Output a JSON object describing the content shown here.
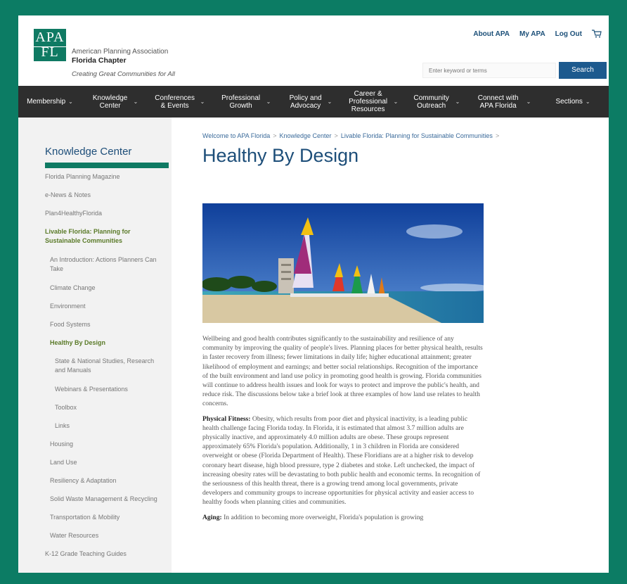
{
  "header": {
    "logo_top": "APA",
    "logo_bottom": "FL",
    "org_name": "American Planning Association",
    "chapter": "Florida Chapter",
    "tagline": "Creating Great Communities for All",
    "links": [
      "About APA",
      "My APA",
      "Log Out"
    ],
    "search_placeholder": "Enter keyword or terms",
    "search_button": "Search"
  },
  "nav": [
    {
      "label": "Membership"
    },
    {
      "label": "Knowledge Center"
    },
    {
      "label": "Conferences & Events"
    },
    {
      "label": "Professional Growth"
    },
    {
      "label": "Policy and Advocacy"
    },
    {
      "label": "Career & Professional Resources"
    },
    {
      "label": "Community Outreach"
    },
    {
      "label": "Connect with APA Florida"
    },
    {
      "label": "Sections"
    }
  ],
  "sidebar": {
    "title": "Knowledge Center",
    "items": [
      {
        "label": "Florida Planning Magazine",
        "level": 0
      },
      {
        "label": "e-News & Notes",
        "level": 0
      },
      {
        "label": "Plan4HealthyFlorida",
        "level": 0
      },
      {
        "label": "Livable Florida: Planning for Sustainable Communities",
        "level": 0,
        "active": true
      },
      {
        "label": "An Introduction: Actions Planners Can Take",
        "level": 1
      },
      {
        "label": "Climate Change",
        "level": 1
      },
      {
        "label": "Environment",
        "level": 1
      },
      {
        "label": "Food Systems",
        "level": 1
      },
      {
        "label": "Healthy By Design",
        "level": 1,
        "active": true
      },
      {
        "label": "State & National Studies, Research and Manuals",
        "level": 2
      },
      {
        "label": "Webinars & Presentations",
        "level": 2
      },
      {
        "label": "Toolbox",
        "level": 2
      },
      {
        "label": "Links",
        "level": 2
      },
      {
        "label": "Housing",
        "level": 1
      },
      {
        "label": "Land Use",
        "level": 1
      },
      {
        "label": "Resiliency & Adaptation",
        "level": 1
      },
      {
        "label": "Solid Waste Management & Recycling",
        "level": 1
      },
      {
        "label": "Transportation & Mobility",
        "level": 1
      },
      {
        "label": "Water Resources",
        "level": 1
      },
      {
        "label": "K-12 Grade Teaching Guides",
        "level": 0
      }
    ]
  },
  "breadcrumb": [
    "Welcome to APA Florida",
    "Knowledge Center",
    "Livable Florida: Planning for Sustainable Communities"
  ],
  "page_title": "Healthy By Design",
  "content": {
    "intro": "Wellbeing and good health contributes significantly to the sustainability and resilience of any community by improving the quality of people's lives. Planning places for better physical health, results in faster recovery from illness; fewer limitations in daily life; higher educational attainment; greater likelihood of employment and earnings; and better social relationships. Recognition of the importance of the built environment and land use policy in promoting good health is growing. Florida communities will continue to address health issues and look for ways to protect and improve the public's health, and reduce risk. The discussions below take a brief look at three examples of how land use relates to health concerns.",
    "fitness_label": "Physical Fitness:",
    "fitness_text": " Obesity, which results from poor diet and physical inactivity, is a leading public health challenge facing Florida today. In Florida, it is estimated that almost 3.7 million adults are physically inactive, and approximately 4.0 million adults are obese. These groups represent approximately 65% Florida's population. Additionally, 1 in 3 children in Florida are considered overweight or obese (Florida Department of Health). These Floridians are at a higher risk to develop coronary heart disease, high blood pressure, type 2 diabetes and stoke. Left unchecked, the impact of increasing obesity rates will be devastating to both public health and economic terms. In recognition of the seriousness of this health threat, there is a growing trend among local governments, private developers and community groups to increase opportunities for physical activity and easier access to healthy foods when planning cities and communities.",
    "aging_label": "Aging:",
    "aging_text": " In addition to becoming more overweight, Florida's population is growing"
  },
  "colors": {
    "brand_green": "#0f7a63",
    "nav_bg": "#2e2e2e",
    "title_blue": "#1d4e79",
    "button_blue": "#1d5a8e"
  }
}
